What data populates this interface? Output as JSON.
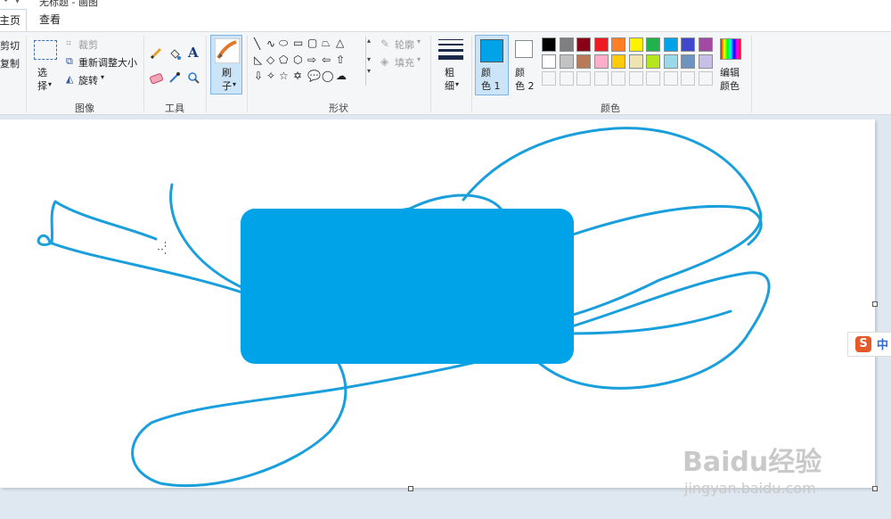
{
  "window": {
    "title": "无标题 - 画图"
  },
  "tabs": {
    "home": "主页",
    "view": "查看"
  },
  "clipboard": {
    "cut": "剪切",
    "copy": "复制"
  },
  "image": {
    "select": "选\n择",
    "crop": "裁剪",
    "resize": "重新调整大小",
    "rotate": "旋转",
    "group_label": "图像"
  },
  "tools": {
    "group_label": "工具"
  },
  "brushes": {
    "label": "刷\n子"
  },
  "shapes": {
    "outline": "轮廓",
    "fill": "填充",
    "group_label": "形状"
  },
  "size": {
    "label": "粗\n细"
  },
  "colors": {
    "color1_label": "颜\n色 1",
    "color2_label": "颜\n色 2",
    "edit_label": "编辑\n颜色",
    "group_label": "颜色",
    "color1": "#00a2e8",
    "color2": "#ffffff",
    "palette_row1": [
      "#000000",
      "#7f7f7f",
      "#880015",
      "#ed1c24",
      "#ff7f27",
      "#fff200",
      "#22b14c",
      "#00a2e8",
      "#3f48cc",
      "#a349a4"
    ],
    "palette_row2": [
      "#ffffff",
      "#c3c3c3",
      "#b97a57",
      "#ffaec9",
      "#ffc90e",
      "#efe4b0",
      "#b5e61d",
      "#99d9ea",
      "#7092be",
      "#c8bfe7"
    ]
  },
  "canvas": {
    "fill": "#00a2e8",
    "stroke": "#1a9fdc"
  },
  "ime": {
    "label": "中"
  },
  "watermark": {
    "brand": "Baidu经验",
    "url": "jingyan.baidu.com"
  }
}
